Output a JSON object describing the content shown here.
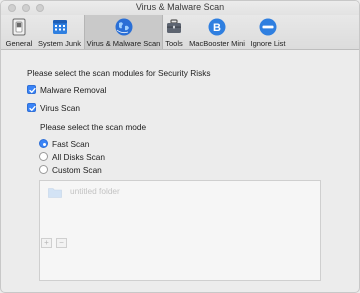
{
  "window": {
    "title": "Virus & Malware Scan"
  },
  "toolbar": {
    "tabs": [
      {
        "label": "General",
        "icon": "switch-icon"
      },
      {
        "label": "System Junk",
        "icon": "calendar-grid-icon"
      },
      {
        "label": "Virus & Malware Scan",
        "icon": "globe-icon",
        "active": true
      },
      {
        "label": "Tools",
        "icon": "toolbox-icon"
      },
      {
        "label": "MacBooster Mini",
        "icon": "b-circle-icon"
      },
      {
        "label": "Ignore List",
        "icon": "minus-circle-icon"
      }
    ]
  },
  "modules": {
    "heading": "Please select the scan modules for Security Risks",
    "malware_label": "Malware Removal",
    "virus_label": "Virus Scan",
    "malware_checked": true,
    "virus_checked": true
  },
  "scan_mode": {
    "heading": "Please select the scan mode",
    "options": [
      "Fast Scan",
      "All Disks Scan",
      "Custom Scan"
    ],
    "selected": "Fast Scan"
  },
  "custom_list": {
    "items": [
      "untitled folder"
    ],
    "add_label": "+",
    "remove_label": "−"
  },
  "colors": {
    "accent": "#3a84f7",
    "window_bg": "#ececec"
  }
}
